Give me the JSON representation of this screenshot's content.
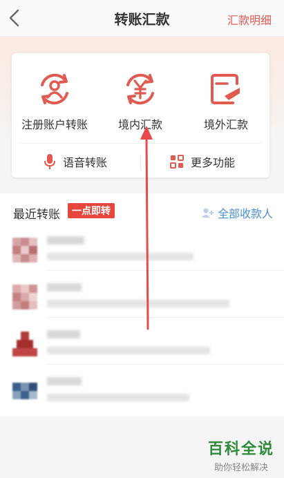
{
  "header": {
    "title": "转账汇款",
    "details_label": "汇款明细"
  },
  "functions": [
    {
      "label": "注册账户转账",
      "icon": "user-exchange-icon"
    },
    {
      "label": "境内汇款",
      "icon": "yuan-exchange-icon"
    },
    {
      "label": "境外汇款",
      "icon": "overseas-card-icon"
    }
  ],
  "sub_functions": [
    {
      "label": "语音转账",
      "icon": "microphone-icon"
    },
    {
      "label": "更多功能",
      "icon": "grid-icon"
    }
  ],
  "recent": {
    "title": "最近转账",
    "tag": "一点即转",
    "all_label": "全部收款人"
  },
  "colors": {
    "accent": "#e2594f",
    "link": "#4a8fd8",
    "tag": "#e6463c",
    "watermark": "#2e8b3a"
  },
  "watermark": {
    "main": "百科全说",
    "sub": "助你轻松解决"
  }
}
